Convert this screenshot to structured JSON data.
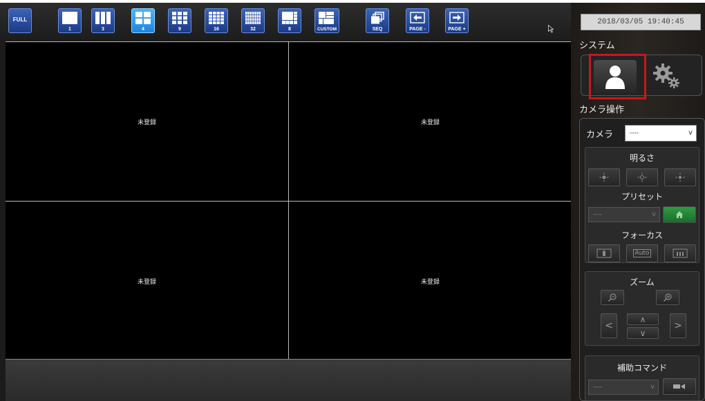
{
  "toolbar": {
    "buttons": [
      {
        "id": "full",
        "label": "FULL"
      },
      {
        "id": "layout-1",
        "label": "1"
      },
      {
        "id": "layout-3",
        "label": "3"
      },
      {
        "id": "layout-4",
        "label": "4",
        "active": true
      },
      {
        "id": "layout-9",
        "label": "9"
      },
      {
        "id": "layout-16",
        "label": "16"
      },
      {
        "id": "layout-32",
        "label": "32"
      },
      {
        "id": "layout-8",
        "label": "8"
      },
      {
        "id": "custom",
        "label": "CUSTOM"
      },
      {
        "id": "seq",
        "label": "SEQ"
      },
      {
        "id": "page-prev",
        "label": "PAGE -"
      },
      {
        "id": "page-next",
        "label": "PAGE +"
      }
    ],
    "colors": {
      "button": "#2a4fa6",
      "active": "#2fa0f0"
    }
  },
  "grid": {
    "cells": [
      {
        "label": "未登録"
      },
      {
        "label": "未登録"
      },
      {
        "label": "未登録"
      },
      {
        "label": "未登録"
      }
    ]
  },
  "panel": {
    "datetime": "2018/03/05 19:40:45",
    "system_label": "システム",
    "camera_ops_label": "カメラ操作",
    "camera_label": "カメラ",
    "camera_value": "----",
    "brightness_label": "明るさ",
    "preset_label": "プリセット",
    "preset_value": "----",
    "focus_label": "フォーカス",
    "focus_auto": "Auto",
    "zoom_label": "ズーム",
    "aux_command_label": "補助コマンド",
    "aux_value": "----",
    "highlight_color": "#c8171c"
  }
}
